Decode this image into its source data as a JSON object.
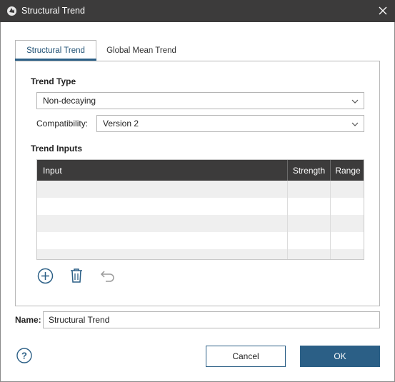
{
  "window": {
    "title": "Structural Trend"
  },
  "tabs": [
    {
      "label": "Structural Trend",
      "active": true
    },
    {
      "label": "Global Mean Trend",
      "active": false
    }
  ],
  "trend_type": {
    "heading": "Trend Type",
    "value": "Non-decaying"
  },
  "compatibility": {
    "label": "Compatibility:",
    "value": "Version 2"
  },
  "trend_inputs": {
    "heading": "Trend Inputs",
    "columns": [
      "Input",
      "Strength",
      "Range"
    ],
    "rows": [
      [
        "",
        "",
        ""
      ],
      [
        "",
        "",
        ""
      ],
      [
        "",
        "",
        ""
      ],
      [
        "",
        "",
        ""
      ],
      [
        "",
        "",
        ""
      ]
    ]
  },
  "toolbar": {
    "icons": [
      "add-icon",
      "delete-icon",
      "undo-icon"
    ]
  },
  "name_field": {
    "label": "Name:",
    "value": "Structural Trend"
  },
  "buttons": {
    "cancel": "Cancel",
    "ok": "OK"
  },
  "colors": {
    "titlebar": "#3c3b3b",
    "accent": "#2b5f86",
    "alt_row": "#efefef"
  }
}
